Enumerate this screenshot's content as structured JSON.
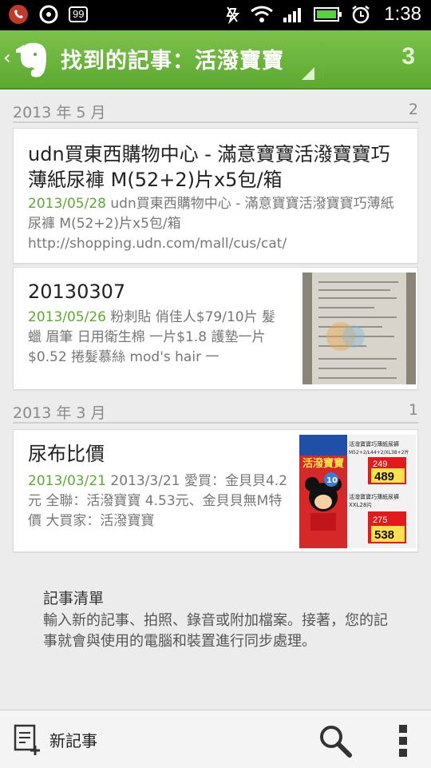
{
  "status_bar": {
    "badge": "99",
    "time": "1:38"
  },
  "header": {
    "title": "找到的記事：活潑寶寶",
    "count": "3",
    "accent": "#5da932"
  },
  "sections": [
    {
      "label": "2013 年 5 月",
      "count": "2",
      "notes": [
        {
          "title": "udn買東西購物中心 - 滿意寶寶活潑寶寶巧薄紙尿褲 M(52+2)片x5包/箱",
          "date": "2013/05/28",
          "snippet": " udn買東西購物中心 - 滿意寶寶活潑寶寶巧薄紙尿褲 M(52+2)片x5包/箱 http://shopping.udn.com/mall/cus/cat/"
        },
        {
          "title": "20130307",
          "date": "2013/05/26",
          "snippet": " 粉刺貼 俏佳人$79/10片 髮蠟 眉筆 日用衛生棉 一片$1.8 護墊一片$0.52 捲髮慕絲 mod's hair 一",
          "thumbnail": "receipt-image"
        }
      ]
    },
    {
      "label": "2013 年 3 月",
      "count": "1",
      "notes": [
        {
          "title": "尿布比價",
          "date": "2013/03/21",
          "snippet": " 2013/3/21 愛買：金貝貝4.2元 全聯：活潑寶寶 4.53元、金貝貝無M特價 大買家：活潑寶寶",
          "thumbnail": "diaper-ad-image",
          "thumb_text": {
            "brand": "活潑寶寶",
            "line1": "活潑寶寶巧薄紙尿褲",
            "line2": "M52+2/L44+2/XL38+2片",
            "price1_small": "249",
            "price1_big": "489",
            "line3": "活潑寶寶巧薄紙尿褲",
            "line4": "XXL28片",
            "price2_small": "275",
            "price2_big": "538",
            "tag": "10"
          }
        }
      ]
    }
  ],
  "empty_state": {
    "title": "記事清單",
    "body": "輸入新的記事、拍照、錄音或附加檔案。接著，您的記事就會與使用的電腦和裝置進行同步處理。"
  },
  "bottom_bar": {
    "new_note_label": "新記事"
  },
  "icons": [
    "evernote-logo",
    "search-icon",
    "overflow-menu-icon",
    "new-note-icon",
    "wifi-icon",
    "signal-icon",
    "battery-icon",
    "alarm-icon",
    "mute-icon"
  ]
}
